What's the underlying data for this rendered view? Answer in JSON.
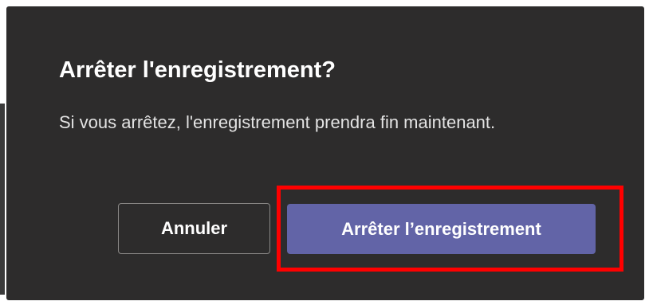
{
  "dialog": {
    "title": "Arrêter l'enregistrement?",
    "message": "Si vous arrêtez, l'enregistrement prendra fin maintenant.",
    "buttons": {
      "cancel_label": "Annuler",
      "confirm_label": "Arrêter l’enregistrement"
    }
  },
  "colors": {
    "dialog_background": "#2d2c2c",
    "primary_button": "#6264a7",
    "cancel_border": "#8a8886",
    "highlight": "#ff0000",
    "text": "#ffffff"
  }
}
